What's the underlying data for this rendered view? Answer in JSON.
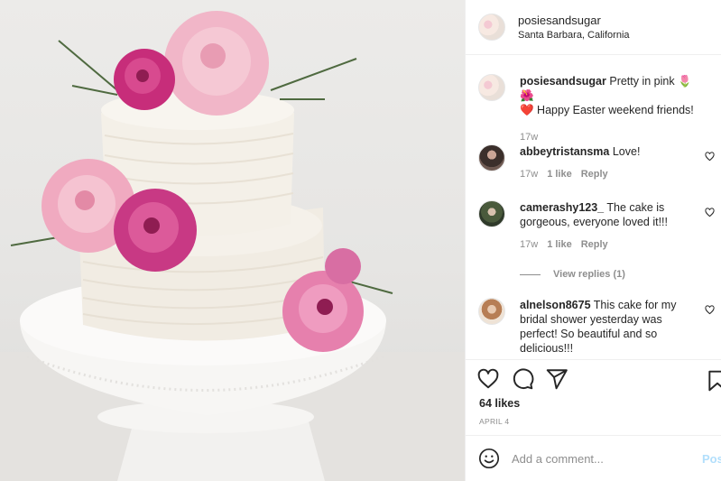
{
  "post": {
    "username": "posiesandsugar",
    "location": "Santa Barbara, California",
    "caption_user": "posiesandsugar",
    "caption_text": "Pretty in pink 🌷🌺",
    "caption_text2": "❤️ Happy Easter weekend friends!",
    "caption_time": "17w"
  },
  "comments": [
    {
      "user": "abbeytristansma",
      "text": "Love!",
      "time": "17w",
      "likes": "1 like",
      "reply": "Reply"
    },
    {
      "user": "camerashy123_",
      "text": "The cake is gorgeous, everyone loved it!!!",
      "time": "17w",
      "likes": "1 like",
      "reply": "Reply"
    },
    {
      "user": "alnelson8675",
      "text": "This cake for my bridal shower yesterday was perfect! So beautiful and so delicious!!!"
    }
  ],
  "view_replies": "View replies (1)",
  "likes_count": "64 likes",
  "post_date": "APRIL 4",
  "add_comment": {
    "placeholder": "Add a comment...",
    "post_label": "Post"
  },
  "icons": [
    "heart-icon",
    "comment-icon",
    "share-icon",
    "bookmark-icon",
    "emoji-icon"
  ],
  "colors": {
    "text": "#262626",
    "muted": "#8e8e8e",
    "post_button": "#b2dffc",
    "border": "#efefef"
  }
}
